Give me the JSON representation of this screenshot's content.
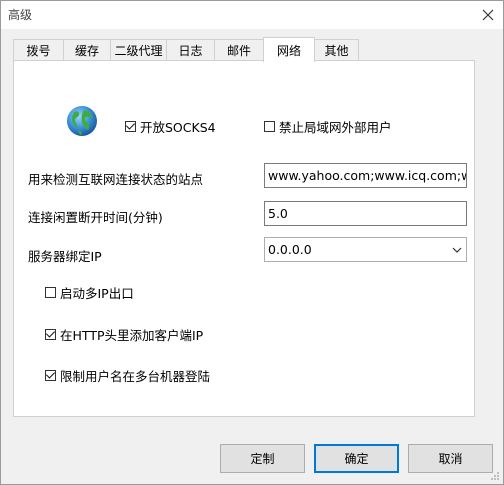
{
  "window": {
    "title": "高级"
  },
  "tabs": [
    {
      "label": "拨号"
    },
    {
      "label": "缓存"
    },
    {
      "label": "二级代理"
    },
    {
      "label": "日志"
    },
    {
      "label": "邮件"
    },
    {
      "label": "网络"
    },
    {
      "label": "其他"
    }
  ],
  "active_tab": "网络",
  "network": {
    "enable_socks4": {
      "label": "开放SOCKS4",
      "checked": true
    },
    "block_lan_external": {
      "label": "禁止局域网外部用户",
      "checked": false
    },
    "check_sites": {
      "label": "用来检测互联网连接状态的站点",
      "value": "www.yahoo.com;www.icq.com;www"
    },
    "idle_disconnect": {
      "label": "连接闲置断开时间(分钟)",
      "value": "5.0"
    },
    "bind_ip": {
      "label": "服务器绑定IP",
      "value": "0.0.0.0"
    },
    "multi_ip": {
      "label": "启动多IP出口",
      "checked": false
    },
    "http_client_ip": {
      "label": "在HTTP头里添加客户端IP",
      "checked": true
    },
    "limit_user_multi": {
      "label": "限制用户名在多台机器登陆",
      "checked": true
    }
  },
  "buttons": {
    "customize": "定制",
    "ok": "确定",
    "cancel": "取消"
  },
  "icons": {
    "close": "close-icon",
    "globe": "globe-icon",
    "dropdown": "chevron-down-icon"
  },
  "colors": {
    "accent": "#0078d7",
    "panel_bg": "#ffffff",
    "window_bg": "#f0f0f0"
  }
}
